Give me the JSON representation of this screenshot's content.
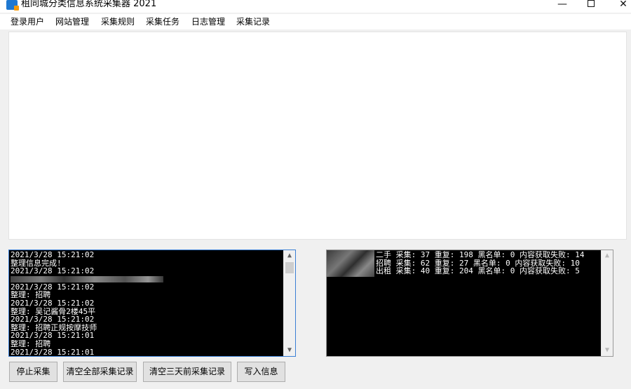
{
  "window": {
    "title": "租同城分类信息系统采集器 2021",
    "controls": {
      "minimize": "—",
      "close": "✕"
    }
  },
  "menu": [
    "登录用户",
    "网站管理",
    "采集规则",
    "采集任务",
    "日志管理",
    "采集记录"
  ],
  "left_log": [
    "2021/3/28 15:21:02",
    "整理信息完成!",
    "2021/3/28 15:21:02",
    "__BLUR__",
    "2021/3/28 15:21:02",
    "整理: 招聘",
    "2021/3/28 15:21:02",
    "整理: 吴记酱骨2楼45平",
    "2021/3/28 15:21:02",
    "整理: 招聘正规按摩技师",
    "2021/3/28 15:21:01",
    "整理: 招聘",
    "2021/3/28 15:21:01"
  ],
  "right_log": [
    "二手 采集: 37 重复: 198 黑名单: 0 内容获取失败: 14",
    "招聘 采集: 62 重复: 27 黑名单: 0 内容获取失败: 10",
    "出租 采集: 40 重复: 204 黑名单: 0 内容获取失败: 5"
  ],
  "buttons": {
    "stop": "停止采集",
    "clear_all": "清空全部采集记录",
    "clear_3days": "清空三天前采集记录",
    "write_info": "写入信息"
  },
  "scroll_arrows": {
    "up": "▲",
    "down": "▼"
  },
  "colors": {
    "console_bg": "#000000",
    "console_text": "#ffffff",
    "focus_border": "#3a7fd5"
  }
}
